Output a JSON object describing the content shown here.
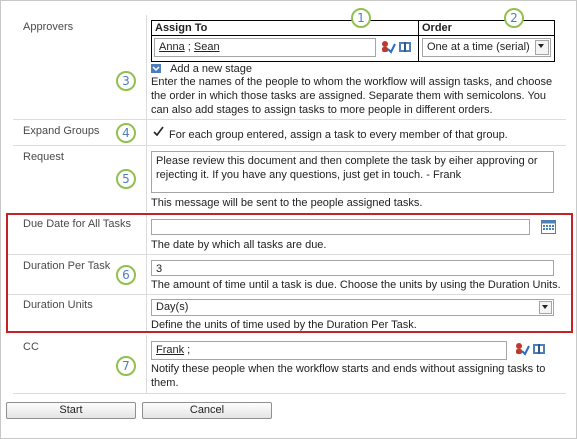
{
  "approvers": {
    "label": "Approvers",
    "assign_to_header": "Assign To",
    "order_header": "Order",
    "people": [
      "Anna",
      "Sean"
    ],
    "people_separator": " ; ",
    "order_value": "One at a time (serial)",
    "add_stage_link": "Add a new stage",
    "description": "Enter the names of the people to whom the workflow will assign tasks, and choose the order in which those tasks are assigned. Separate them with semicolons. You can also add stages to assign tasks to more people in different orders."
  },
  "expand_groups": {
    "label": "Expand Groups",
    "checked": true,
    "text": "For each group entered, assign a task to every member of that group."
  },
  "request": {
    "label": "Request",
    "value": "Please review this document and then complete the task by eiher approving or rejecting it. If you have any questions, just get in touch. - Frank",
    "description": "This message will be sent to the people assigned tasks."
  },
  "due_date": {
    "label": "Due Date for All Tasks",
    "value": "",
    "description": "The date by which all tasks are due."
  },
  "duration_per_task": {
    "label": "Duration Per Task",
    "value": "3",
    "description": "The amount of time until a task is due. Choose the units by using the Duration Units."
  },
  "duration_units": {
    "label": "Duration Units",
    "value": "Day(s)",
    "description": "Define the units of time used by the Duration Per Task."
  },
  "cc": {
    "label": "CC",
    "person": "Frank",
    "suffix": " ;",
    "description": "Notify these people when the workflow starts and ends without assigning tasks to them."
  },
  "buttons": {
    "start": "Start",
    "cancel": "Cancel"
  },
  "callouts": [
    "1",
    "2",
    "3",
    "4",
    "5",
    "6",
    "7"
  ],
  "colors": {
    "highlight_border": "#c62127",
    "callout_ring": "#92c050",
    "callout_text": "#4d7fbf"
  },
  "icons": {
    "check_names": "check-names-icon",
    "browse": "address-book-icon",
    "calendar": "calendar-icon",
    "add_stage": "add-stage-icon"
  }
}
